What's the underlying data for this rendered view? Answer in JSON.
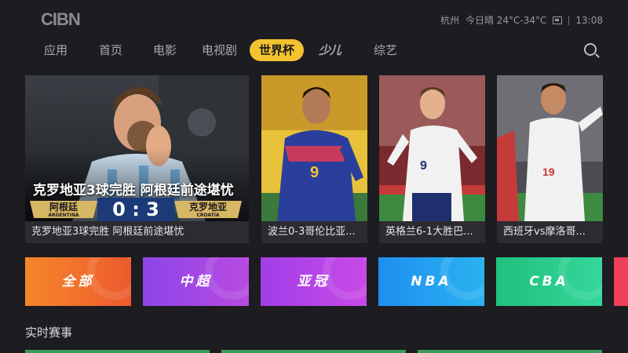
{
  "topbar": {
    "logo": "CIBN",
    "city": "杭州",
    "weather": "今日晴 24°C-34°C",
    "time": "13:08"
  },
  "nav": {
    "items": [
      "应用",
      "首页",
      "电影",
      "电视剧",
      "世界杯",
      "少儿",
      "综艺"
    ],
    "active": "世界杯"
  },
  "featured": [
    {
      "caption": "克罗地亚3球完胜 阿根廷前途堪忧",
      "overlay_title": "克罗地亚3球完胜 阿根廷前途堪忧",
      "team_left": "阿根廷",
      "team_left_en": "ARGENTINA",
      "score": "0 : 3",
      "team_right": "克罗地亚",
      "team_right_en": "CROATIA"
    },
    {
      "caption": "波兰0-3哥伦比亚..."
    },
    {
      "caption": "英格兰6-1大胜巴..."
    },
    {
      "caption": "西班牙vs摩洛哥..."
    }
  ],
  "categories": [
    {
      "label": "全部",
      "color": "#f26b2b"
    },
    {
      "label": "中超",
      "color": "#a441e6"
    },
    {
      "label": "亚冠",
      "color": "#b03ee8"
    },
    {
      "label": "NBA",
      "color": "#1e9bf0"
    },
    {
      "label": "CBA",
      "color": "#27c98a"
    }
  ],
  "sections": {
    "live_title": "实时赛事"
  }
}
